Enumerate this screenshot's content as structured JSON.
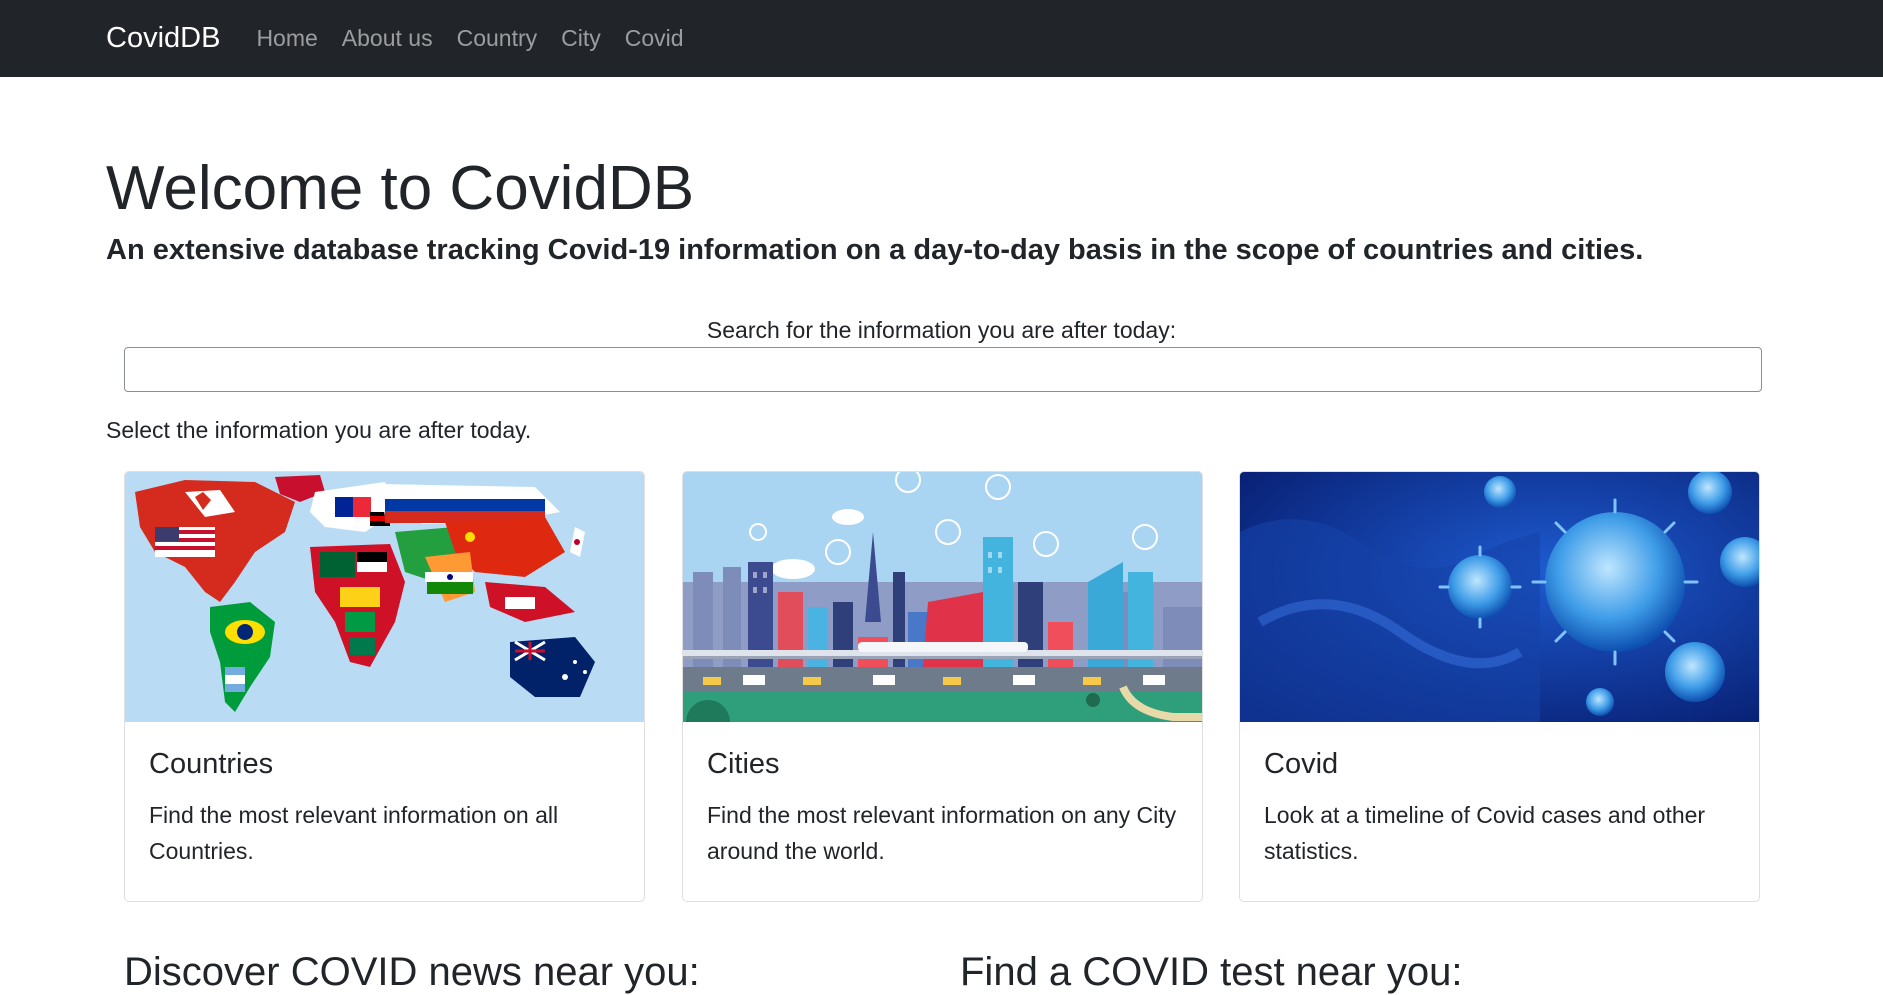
{
  "navbar": {
    "brand": "CovidDB",
    "links": [
      "Home",
      "About us",
      "Country",
      "City",
      "Covid"
    ]
  },
  "hero": {
    "title": "Welcome to CovidDB",
    "subtitle": "An extensive database tracking Covid-19 information on a day-to-day basis in the scope of countries and cities."
  },
  "search": {
    "label": "Search for the information you are after today:",
    "value": "",
    "placeholder": ""
  },
  "select_text": "Select the information you are after today.",
  "cards": [
    {
      "title": "Countries",
      "text": "Find the most relevant information on all Countries.",
      "image": "world-flags-map"
    },
    {
      "title": "Cities",
      "text": "Find the most relevant information on any City around the world.",
      "image": "city-skyline"
    },
    {
      "title": "Covid",
      "text": "Look at a timeline of Covid cases and other statistics.",
      "image": "virus"
    }
  ],
  "sections": {
    "news": "Discover COVID news near you:",
    "test": "Find a COVID test near you:"
  },
  "colors": {
    "navbar": "#212529",
    "text": "#212529"
  }
}
